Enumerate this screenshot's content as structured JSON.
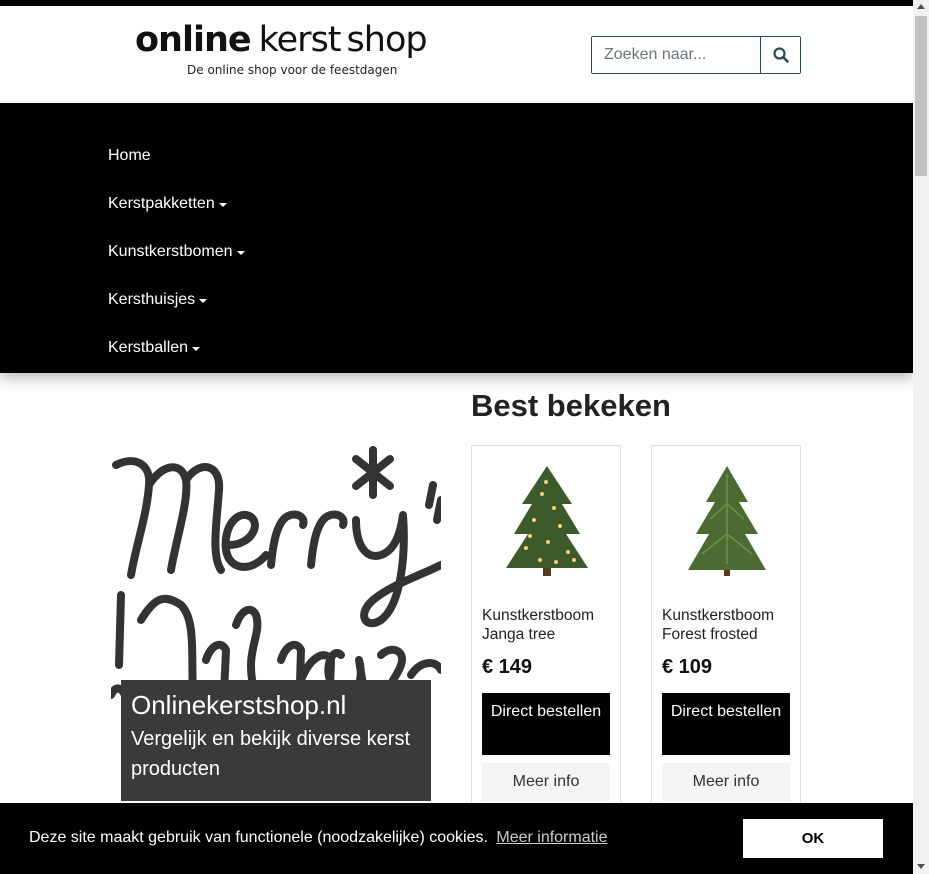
{
  "logo": {
    "word1": "online",
    "word2": "kerst",
    "word3": "shop",
    "tagline": "De online shop voor de feestdagen"
  },
  "search": {
    "placeholder": "Zoeken naar...",
    "icon": "search-icon"
  },
  "nav": {
    "items": [
      {
        "label": "Home",
        "dropdown": false
      },
      {
        "label": "Kerstpakketten",
        "dropdown": true
      },
      {
        "label": "Kunstkerstbomen",
        "dropdown": true
      },
      {
        "label": "Kersthuisjes",
        "dropdown": true
      },
      {
        "label": "Kerstballen",
        "dropdown": true
      }
    ]
  },
  "hero": {
    "image_text": "Merry Christmas",
    "title": "Onlinekerstshop.nl",
    "subtitle": "Vergelijk en bekijk diverse kerst producten"
  },
  "best": {
    "title": "Best bekeken",
    "products": [
      {
        "name": "Kunstkerstboom Janga tree",
        "price": "€ 149",
        "order_label": "Direct bestellen",
        "info_label": "Meer info"
      },
      {
        "name": "Kunstkerstboom Forest frosted",
        "price": "€ 109",
        "order_label": "Direct bestellen",
        "info_label": "Meer info"
      }
    ]
  },
  "cookie": {
    "text": "Deze site maakt gebruik van functionele (noodzakelijke) cookies.",
    "link": "Meer informatie",
    "ok": "OK"
  },
  "colors": {
    "nav_bg": "#000000",
    "accent": "#2b4a57",
    "caption_bg": "#3a3a3a"
  }
}
